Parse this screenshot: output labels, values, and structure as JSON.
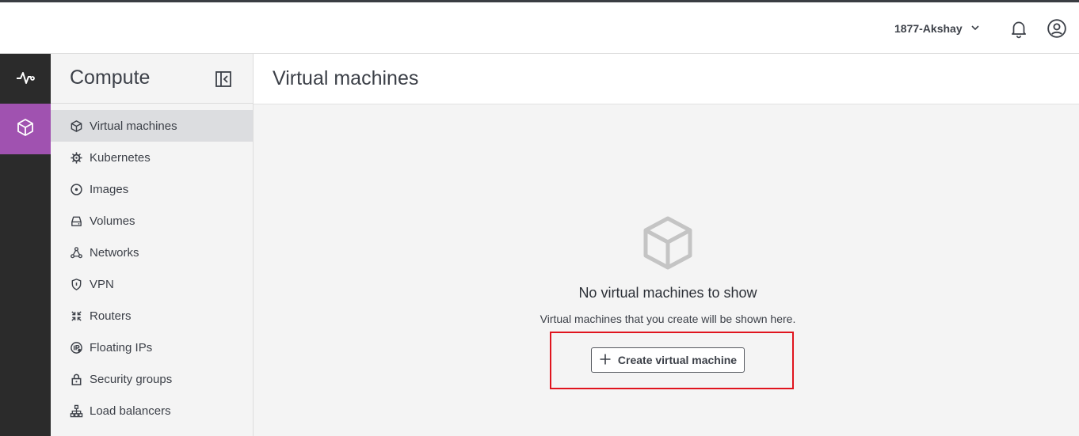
{
  "header": {
    "user_name": "1877-Akshay"
  },
  "sidebar": {
    "title": "Compute",
    "items": [
      {
        "label": "Virtual machines",
        "icon": "cube-icon",
        "active": true
      },
      {
        "label": "Kubernetes",
        "icon": "helm-icon"
      },
      {
        "label": "Images",
        "icon": "disc-icon"
      },
      {
        "label": "Volumes",
        "icon": "drive-icon"
      },
      {
        "label": "Networks",
        "icon": "network-icon"
      },
      {
        "label": "VPN",
        "icon": "shield-icon"
      },
      {
        "label": "Routers",
        "icon": "router-icon"
      },
      {
        "label": "Floating IPs",
        "icon": "ip-icon"
      },
      {
        "label": "Security groups",
        "icon": "lock-icon"
      },
      {
        "label": "Load balancers",
        "icon": "hierarchy-icon"
      }
    ]
  },
  "main": {
    "title": "Virtual machines",
    "empty_title": "No virtual machines to show",
    "empty_desc": "Virtual machines that you create will be shown here.",
    "create_label": "Create virtual machine"
  },
  "colors": {
    "rail_bg": "#2b2b2b",
    "rail_active": "#a052b0",
    "highlight": "#e0141e"
  }
}
